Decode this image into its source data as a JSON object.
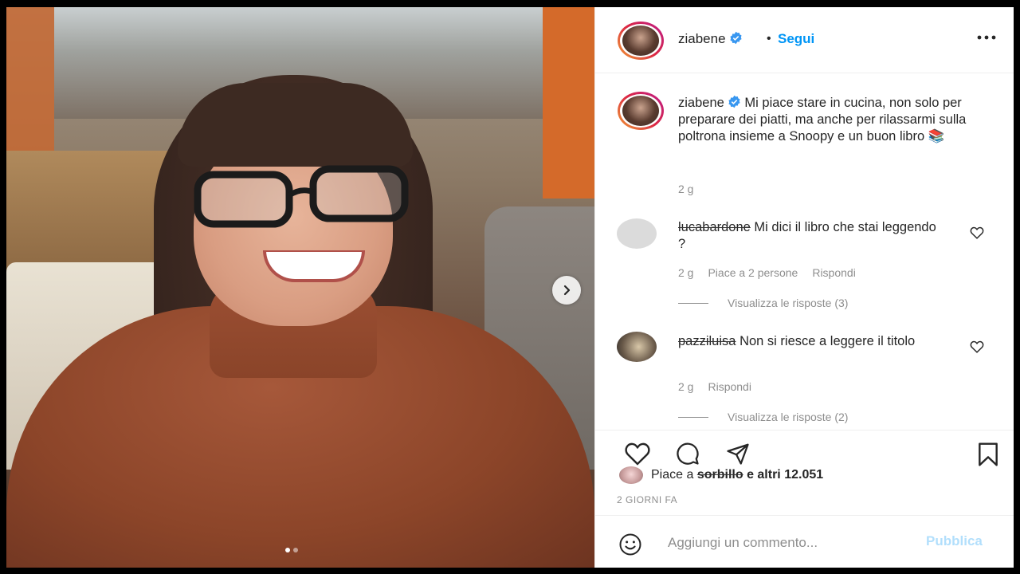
{
  "post": {
    "username": "ziabene",
    "follow_label": "Segui",
    "separator": "•",
    "caption": "Mi piace stare in cucina, non solo per preparare dei piatti, ma anche per rilassarmi sulla poltrona insieme a Snoopy e un buon libro 📚",
    "caption_time": "2 g",
    "image_index": 1,
    "image_count": 2
  },
  "comments": [
    {
      "username": "lucabardone",
      "text": "Mi dici il libro che stai leggendo ?",
      "time": "2 g",
      "likes_label": "Piace a 2 persone",
      "reply_label": "Rispondi",
      "view_replies": "Visualizza le risposte (3)"
    },
    {
      "username": "pazziluisa",
      "text": "Non si riesce a leggere il titolo",
      "time": "2 g",
      "reply_label": "Rispondi",
      "view_replies": "Visualizza le risposte (2)"
    }
  ],
  "likes": {
    "prefix": "Piace a",
    "user": "sorbillo",
    "suffix": "e altri 12.051"
  },
  "date": "2 GIORNI FA",
  "add_comment": {
    "placeholder": "Aggiungi un commento...",
    "publish_label": "Pubblica"
  },
  "colors": {
    "accent": "#0095f6",
    "publish_disabled": "#b2dffc",
    "muted": "#8e8e8e",
    "text": "#262626"
  },
  "icons": {
    "verified": "verified-badge-icon",
    "more": "more-options-icon",
    "next": "chevron-right-icon",
    "like": "heart-icon",
    "comment": "comment-bubble-icon",
    "share": "paper-plane-icon",
    "save": "bookmark-icon",
    "emoji": "emoji-smiley-icon"
  }
}
